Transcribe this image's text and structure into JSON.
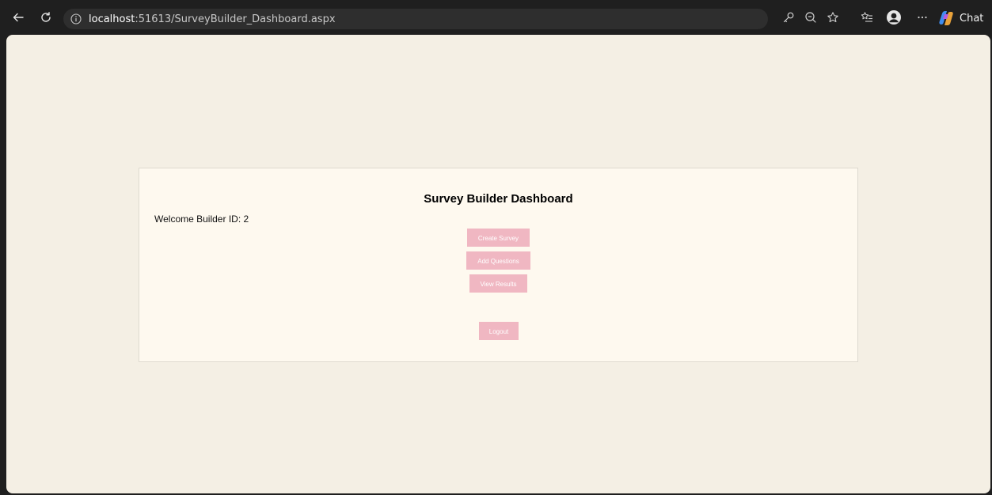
{
  "browser": {
    "url_host": "localhost",
    "url_rest": ":51613/SurveyBuilder_Dashboard.aspx",
    "chat_label": "Chat"
  },
  "page": {
    "title": "Survey Builder Dashboard",
    "welcome_label": "Welcome Builder ID:",
    "builder_id": "2",
    "buttons": {
      "create_survey": "Create Survey",
      "add_questions": "Add Questions",
      "view_results": "View Results",
      "logout": "Logout"
    },
    "colors": {
      "button_bg": "#f0b7c2",
      "panel_bg": "#fef9ef",
      "page_bg": "#f4efe4"
    }
  }
}
